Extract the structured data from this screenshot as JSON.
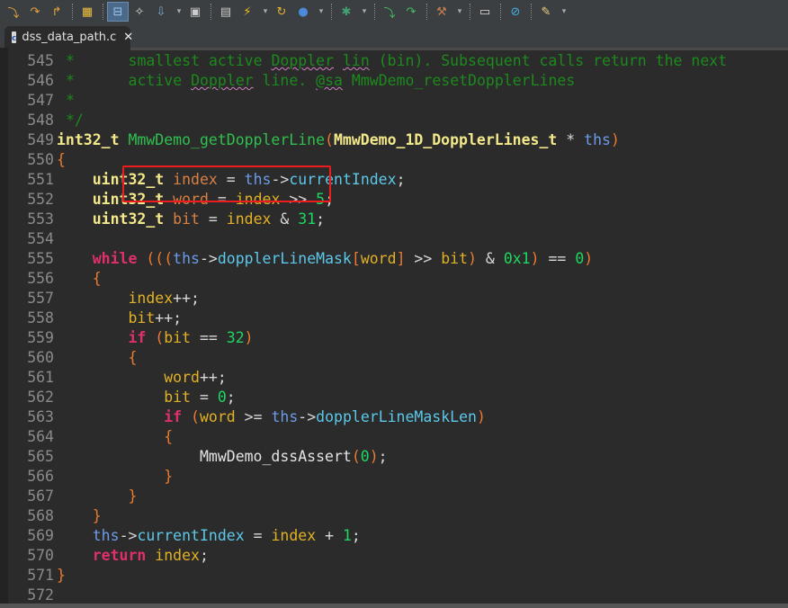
{
  "toolbar": {
    "icons": [
      "step-into-icon",
      "step-over-icon",
      "step-return-icon",
      "grid-icon",
      "connect-target-icon",
      "wand-icon",
      "load-program-icon",
      "dropdown",
      "memory-icon",
      "registers-icon",
      "flash-icon",
      "dropdown",
      "restart-icon",
      "add-watch-icon",
      "dropdown",
      "debug-bug-icon",
      "dropdown",
      "asm-step-into-icon",
      "asm-step-over-icon",
      "build-hammer-icon",
      "dropdown",
      "console-icon",
      "search-icon",
      "pencil-icon",
      "dropdown"
    ]
  },
  "tab": {
    "filename": "dss_data_path.c",
    "file_icon": "c",
    "close": "✕"
  },
  "colors": {
    "highlight_box": "#ee1c1c",
    "function": "#2fc04e",
    "type": "#f4e98a",
    "keyword": "#e0306a",
    "comment": "#1c8a1c"
  },
  "code": [
    {
      "n": "545",
      "t": [
        [
          "cm",
          "*      smallest active "
        ],
        [
          "cm sq",
          "Doppler"
        ],
        [
          "cm",
          " "
        ],
        [
          "cm sq",
          "lin"
        ],
        [
          "cm",
          " (bin). Subsequent calls return the next"
        ]
      ]
    },
    {
      "n": "546",
      "t": [
        [
          "cm",
          "*      active "
        ],
        [
          "cm sq",
          "Doppler"
        ],
        [
          "cm",
          " line. "
        ],
        [
          "cm sq",
          "@sa"
        ],
        [
          "cm",
          " MmwDemo_resetDopplerLines"
        ]
      ]
    },
    {
      "n": "547",
      "t": [
        [
          "cm",
          "*"
        ]
      ]
    },
    {
      "n": "548",
      "t": [
        [
          "cm",
          "*/"
        ]
      ]
    },
    {
      "n": "549",
      "t": [
        [
          "ty",
          "int32_t"
        ],
        [
          "op",
          " "
        ],
        [
          "fn",
          "MmwDemo_getDopplerLine"
        ],
        [
          "br",
          "("
        ],
        [
          "ty",
          "MmwDemo_1D_DopplerLines_t"
        ],
        [
          "op",
          " * "
        ],
        [
          "p",
          "ths"
        ],
        [
          "br",
          ")"
        ]
      ],
      "root": true
    },
    {
      "n": "550",
      "t": [
        [
          "br",
          "{"
        ]
      ],
      "root": true
    },
    {
      "n": "551",
      "t": [
        [
          "op",
          "    "
        ],
        [
          "ty",
          "uint32_t"
        ],
        [
          "op",
          " "
        ],
        [
          "vd",
          "index"
        ],
        [
          "op",
          " = "
        ],
        [
          "p",
          "ths"
        ],
        [
          "op",
          "->"
        ],
        [
          "fld",
          "currentIndex"
        ],
        [
          "op",
          ";"
        ]
      ]
    },
    {
      "n": "552",
      "t": [
        [
          "op",
          "    "
        ],
        [
          "ty",
          "uint32_t"
        ],
        [
          "op",
          " "
        ],
        [
          "vd",
          "word"
        ],
        [
          "op",
          " = "
        ],
        [
          "lv",
          "index"
        ],
        [
          "op",
          " >> "
        ],
        [
          "num",
          "5"
        ],
        [
          "op",
          ";"
        ]
      ]
    },
    {
      "n": "553",
      "t": [
        [
          "op",
          "    "
        ],
        [
          "ty",
          "uint32_t"
        ],
        [
          "op",
          " "
        ],
        [
          "vd",
          "bit"
        ],
        [
          "op",
          " = "
        ],
        [
          "lv",
          "index"
        ],
        [
          "op",
          " & "
        ],
        [
          "num",
          "31"
        ],
        [
          "op",
          ";"
        ]
      ]
    },
    {
      "n": "554",
      "t": []
    },
    {
      "n": "555",
      "t": [
        [
          "op",
          "    "
        ],
        [
          "kw",
          "while"
        ],
        [
          "op",
          " "
        ],
        [
          "br",
          "((("
        ],
        [
          "p",
          "ths"
        ],
        [
          "op",
          "->"
        ],
        [
          "fld",
          "dopplerLineMask"
        ],
        [
          "br",
          "["
        ],
        [
          "lv",
          "word"
        ],
        [
          "br",
          "]"
        ],
        [
          "op",
          " >> "
        ],
        [
          "lv",
          "bit"
        ],
        [
          "br",
          ")"
        ],
        [
          "op",
          " & "
        ],
        [
          "num",
          "0x1"
        ],
        [
          "br",
          ")"
        ],
        [
          "op",
          " == "
        ],
        [
          "num",
          "0"
        ],
        [
          "br",
          ")"
        ]
      ]
    },
    {
      "n": "556",
      "t": [
        [
          "op",
          "    "
        ],
        [
          "br",
          "{"
        ]
      ]
    },
    {
      "n": "557",
      "t": [
        [
          "op",
          "        "
        ],
        [
          "lv",
          "index"
        ],
        [
          "op",
          "++;"
        ]
      ]
    },
    {
      "n": "558",
      "t": [
        [
          "op",
          "        "
        ],
        [
          "lv",
          "bit"
        ],
        [
          "op",
          "++;"
        ]
      ]
    },
    {
      "n": "559",
      "t": [
        [
          "op",
          "        "
        ],
        [
          "kw",
          "if"
        ],
        [
          "op",
          " "
        ],
        [
          "br",
          "("
        ],
        [
          "lv",
          "bit"
        ],
        [
          "op",
          " == "
        ],
        [
          "num",
          "32"
        ],
        [
          "br",
          ")"
        ]
      ]
    },
    {
      "n": "560",
      "t": [
        [
          "op",
          "        "
        ],
        [
          "br",
          "{"
        ]
      ]
    },
    {
      "n": "561",
      "t": [
        [
          "op",
          "            "
        ],
        [
          "lv",
          "word"
        ],
        [
          "op",
          "++;"
        ]
      ]
    },
    {
      "n": "562",
      "t": [
        [
          "op",
          "            "
        ],
        [
          "lv",
          "bit"
        ],
        [
          "op",
          " = "
        ],
        [
          "num",
          "0"
        ],
        [
          "op",
          ";"
        ]
      ]
    },
    {
      "n": "563",
      "t": [
        [
          "op",
          "            "
        ],
        [
          "kw",
          "if"
        ],
        [
          "op",
          " "
        ],
        [
          "br",
          "("
        ],
        [
          "lv",
          "word"
        ],
        [
          "op",
          " >= "
        ],
        [
          "p",
          "ths"
        ],
        [
          "op",
          "->"
        ],
        [
          "fld",
          "dopplerLineMaskLen"
        ],
        [
          "br",
          ")"
        ]
      ]
    },
    {
      "n": "564",
      "t": [
        [
          "op",
          "            "
        ],
        [
          "br",
          "{"
        ]
      ]
    },
    {
      "n": "565",
      "t": [
        [
          "op",
          "                "
        ],
        [
          "call",
          "MmwDemo_dssAssert"
        ],
        [
          "br",
          "("
        ],
        [
          "num",
          "0"
        ],
        [
          "br",
          ")"
        ],
        [
          "op",
          ";"
        ]
      ]
    },
    {
      "n": "566",
      "t": [
        [
          "op",
          "            "
        ],
        [
          "br",
          "}"
        ]
      ]
    },
    {
      "n": "567",
      "t": [
        [
          "op",
          "        "
        ],
        [
          "br",
          "}"
        ]
      ]
    },
    {
      "n": "568",
      "t": [
        [
          "op",
          "    "
        ],
        [
          "br",
          "}"
        ]
      ]
    },
    {
      "n": "569",
      "t": [
        [
          "op",
          "    "
        ],
        [
          "p",
          "ths"
        ],
        [
          "op",
          "->"
        ],
        [
          "fld",
          "currentIndex"
        ],
        [
          "op",
          " = "
        ],
        [
          "lv",
          "index"
        ],
        [
          "op",
          " + "
        ],
        [
          "num",
          "1"
        ],
        [
          "op",
          ";"
        ]
      ]
    },
    {
      "n": "570",
      "t": [
        [
          "op",
          "    "
        ],
        [
          "kw",
          "return"
        ],
        [
          "op",
          " "
        ],
        [
          "lv",
          "index"
        ],
        [
          "op",
          ";"
        ]
      ]
    },
    {
      "n": "571",
      "t": [
        [
          "br",
          "}"
        ]
      ],
      "root": true
    },
    {
      "n": "572",
      "t": []
    }
  ]
}
